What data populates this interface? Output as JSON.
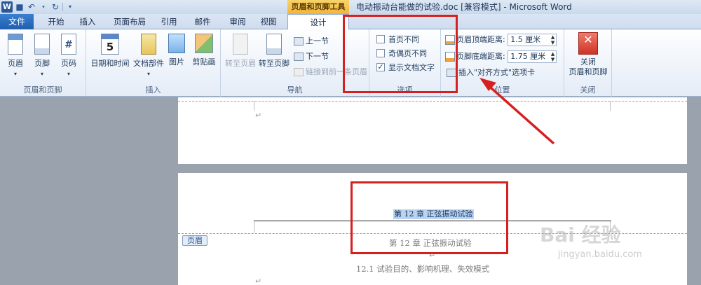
{
  "titlebar": {
    "context_tools": "页眉和页脚工具",
    "window_title": "电动振动台能做的试验.doc [兼容模式] - Microsoft Word"
  },
  "tabs": {
    "file": "文件",
    "items": [
      "开始",
      "插入",
      "页面布局",
      "引用",
      "邮件",
      "审阅",
      "视图",
      "设计"
    ]
  },
  "ribbon": {
    "group_header_footer": {
      "label": "页眉和页脚",
      "header": "页眉",
      "footer": "页脚",
      "page_number": "页码"
    },
    "group_insert": {
      "label": "插入",
      "date_time": "日期和时间",
      "doc_parts": "文档部件",
      "picture": "图片",
      "clip_art": "剪贴画"
    },
    "group_nav": {
      "label": "导航",
      "goto_header": "转至页眉",
      "goto_footer": "转至页脚",
      "prev_section": "上一节",
      "next_section": "下一节",
      "link_previous": "链接到前一条页眉"
    },
    "group_options": {
      "label": "选项",
      "diff_first": "首页不同",
      "diff_odd_even": "奇偶页不同",
      "show_doc_text": "显示文档文字",
      "show_doc_text_checked": "✓"
    },
    "group_position": {
      "label": "位置",
      "header_from_top_label": "页眉顶端距离:",
      "header_from_top_value": "1.5 厘米",
      "footer_from_bottom_label": "页脚底端距离:",
      "footer_from_bottom_value": "1.75 厘米",
      "insert_align_tab": "插入\"对齐方式\"选项卡"
    },
    "group_close": {
      "label": "关闭",
      "close_btn": "关闭\n页眉和页脚"
    }
  },
  "document": {
    "header_text_selected": "第 12 章  正弦振动试验",
    "header_tag": "页眉",
    "chapter_title": "第 12 章    正弦振动试验",
    "section_title": "12.1  试验目的、影响机理、失效模式",
    "para_mark": "↵"
  },
  "watermark": {
    "main": "Bai 经验",
    "sub": "jingyan.baidu.com"
  },
  "colors": {
    "annotation_red": "#d62020",
    "file_tab_blue": "#1f5fae",
    "context_tab_gold": "#f2b43b"
  }
}
